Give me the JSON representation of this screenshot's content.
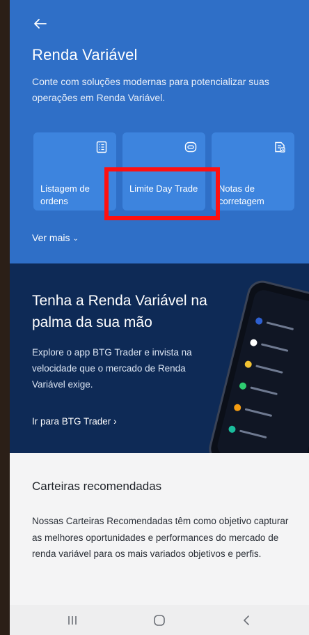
{
  "header": {
    "back_icon": "arrow-left-icon",
    "title": "Renda Variável",
    "subtitle": "Conte com soluções modernas para potencializar suas operações em Renda Variável."
  },
  "cards": [
    {
      "label": "Listagem de ordens",
      "icon": "list-document-icon"
    },
    {
      "label": "Limite Day Trade",
      "icon": "toggle-card-icon"
    },
    {
      "label": "Notas de corretagem",
      "icon": "document-chart-icon"
    }
  ],
  "ver_mais": {
    "label": "Ver mais",
    "icon": "chevron-down-icon"
  },
  "promo": {
    "title": "Tenha a Renda Variável na palma da sua mão",
    "subtitle": "Explore o app BTG Trader e invista na velocidade que o mercado de Renda Variável exige.",
    "link_label": "Ir para BTG Trader",
    "link_icon": "chevron-right-icon"
  },
  "section": {
    "title": "Carteiras recomendadas",
    "body": "Nossas Carteiras Recomendadas têm como objetivo capturar as melhores oportunidades e performances do mercado de renda variável para os mais variados objetivos e perfis."
  },
  "colors": {
    "hero_bg": "#2f6fc7",
    "card_bg": "#3d84de",
    "promo_bg": "#0e2a56",
    "highlight": "#ff1010"
  },
  "navbar": {
    "recent_icon": "recent-apps-icon",
    "home_icon": "home-circle-icon",
    "back_icon": "back-chevron-icon"
  }
}
